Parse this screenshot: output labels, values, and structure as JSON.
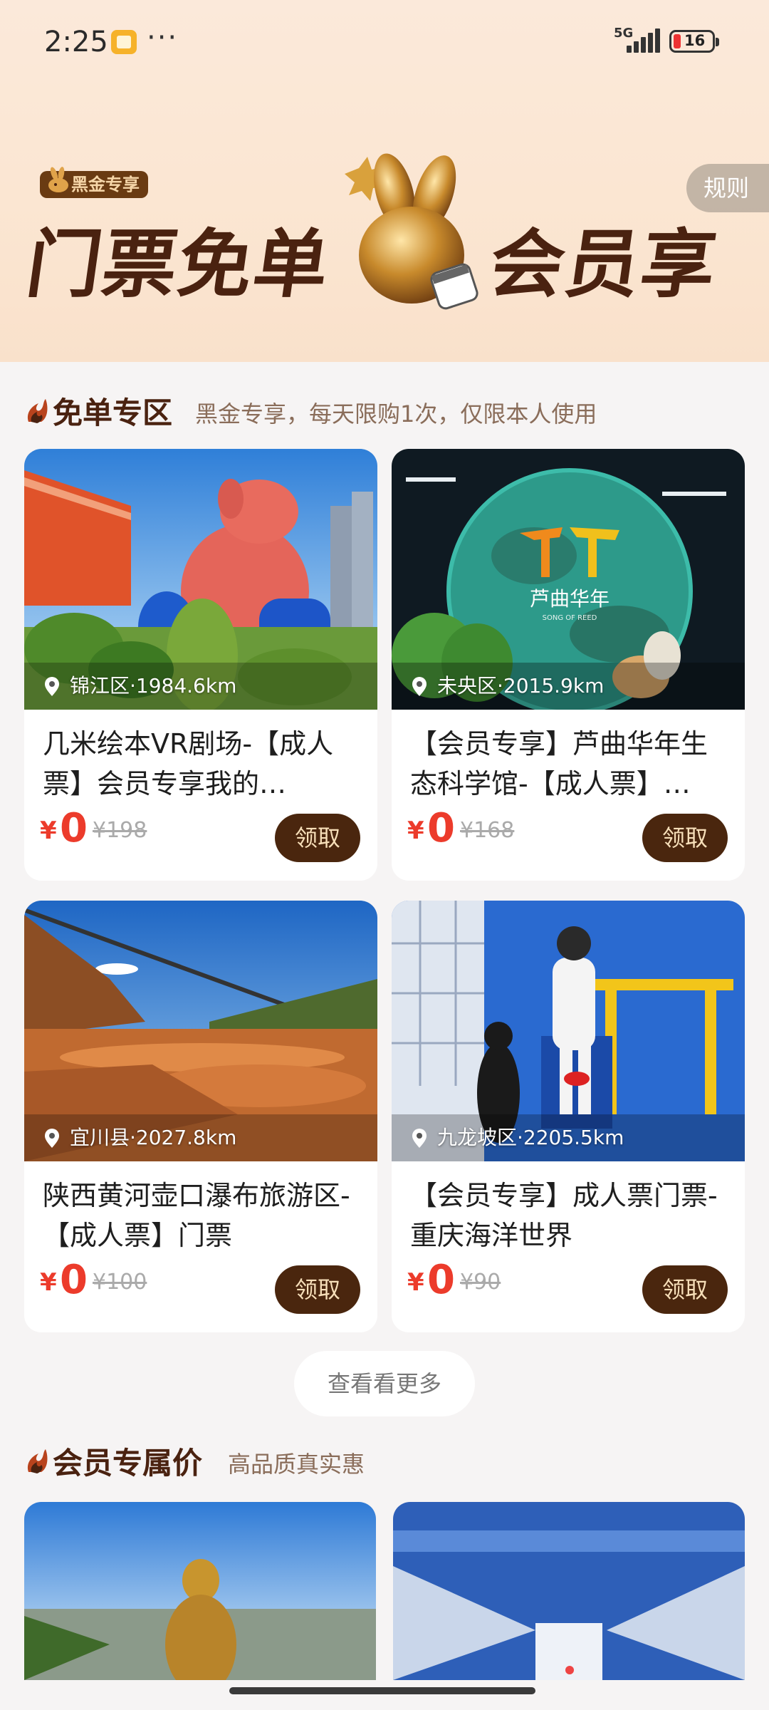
{
  "status_bar": {
    "time": "2:25",
    "dots": "···",
    "network": "5G",
    "battery": "16"
  },
  "hero": {
    "badge": "黑金专享",
    "title_left": "门票免单",
    "title_right": "会员享",
    "rules": "规则"
  },
  "free_section": {
    "title": "免单专区",
    "subtitle": "黑金专享，每天限购1次，仅限本人使用"
  },
  "cards": [
    {
      "location": "锦江区·1984.6km",
      "title": "几米绘本VR剧场-【成人票】会员专享我的…",
      "currency": "¥",
      "price": "0",
      "original": "¥198",
      "button": "领取"
    },
    {
      "location": "未央区·2015.9km",
      "title": "【会员专享】芦曲华年生态科学馆-【成人票】…",
      "currency": "¥",
      "price": "0",
      "original": "¥168",
      "button": "领取"
    },
    {
      "location": "宜川县·2027.8km",
      "title": "陕西黄河壶口瀑布旅游区-【成人票】门票",
      "currency": "¥",
      "price": "0",
      "original": "¥100",
      "button": "领取"
    },
    {
      "location": "九龙坡区·2205.5km",
      "title": "【会员专享】成人票门票-重庆海洋世界",
      "currency": "¥",
      "price": "0",
      "original": "¥90",
      "button": "领取"
    }
  ],
  "more_button": "查看看更多",
  "member_section": {
    "title": "会员专属价",
    "subtitle": "高品质真实惠"
  },
  "image_texts": {
    "reed_logo": "芦曲华年",
    "reed_sub": "SONG OF REED"
  },
  "icons": [
    "location-pin-icon",
    "flame-icon",
    "bunny-icon"
  ],
  "colors": {
    "accent": "#ec3b2b",
    "brand_dark": "#4a260e",
    "gold": "#f7dfb9"
  }
}
